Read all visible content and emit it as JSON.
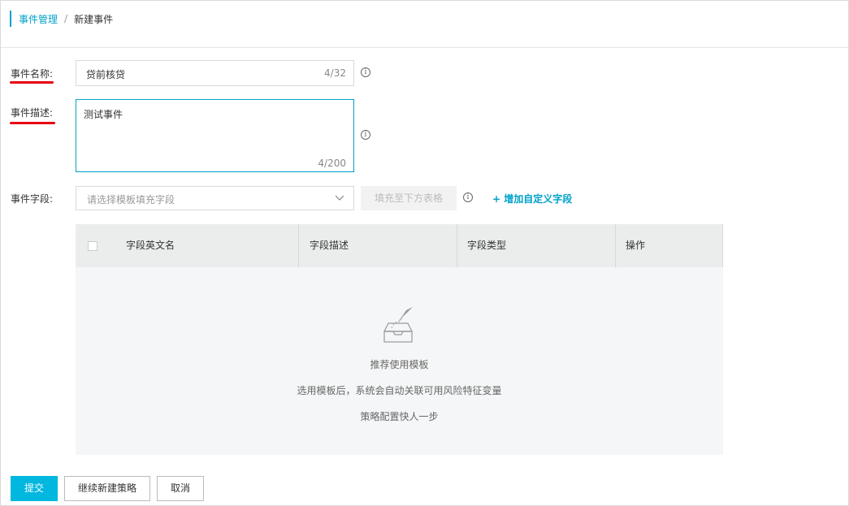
{
  "breadcrumb": {
    "parent": "事件管理",
    "separator": "/",
    "current": "新建事件"
  },
  "form": {
    "event_name": {
      "label": "事件名称:",
      "value": "贷前核贷",
      "counter": "4/32"
    },
    "event_description": {
      "label": "事件描述:",
      "value": "测试事件",
      "counter": "4/200"
    },
    "event_fields": {
      "label": "事件字段:",
      "placeholder": "请选择模板填充字段",
      "fill_button": "填充至下方表格",
      "add_custom": "+ 增加自定义字段"
    }
  },
  "table": {
    "columns": [
      "字段英文名",
      "字段描述",
      "字段类型",
      "操作"
    ],
    "rows": [],
    "empty": {
      "title": "推荐使用模板",
      "line1": "选用模板后，系统会自动关联可用风险特征变量",
      "line2": "策略配置快人一步"
    }
  },
  "actions": {
    "submit": "提交",
    "continue_strategy": "继续新建策略",
    "cancel": "取消"
  },
  "colors": {
    "accent": "#00a2ca",
    "primary_button": "#00b7e0",
    "annotation_red": "#e60012"
  }
}
